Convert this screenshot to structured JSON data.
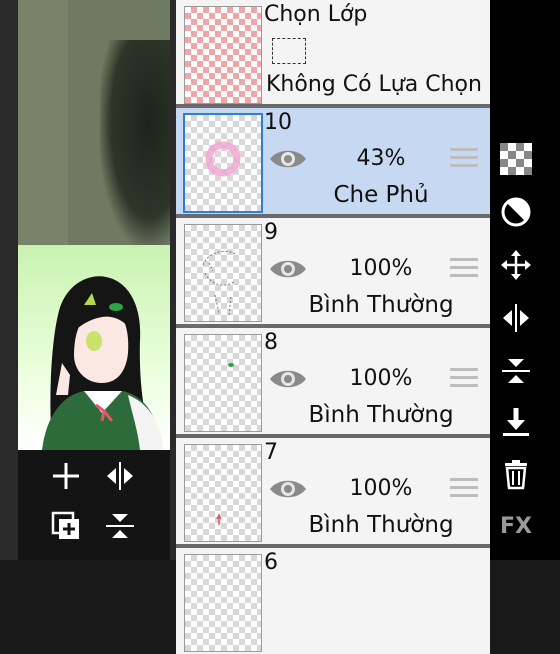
{
  "selection_layer": {
    "title": "Chọn Lớp",
    "status": "Không Có Lựa Chọn"
  },
  "layers": [
    {
      "number": "10",
      "opacity": "43%",
      "blend": "Che Phủ",
      "active": true
    },
    {
      "number": "9",
      "opacity": "100%",
      "blend": "Bình Thường",
      "active": false
    },
    {
      "number": "8",
      "opacity": "100%",
      "blend": "Bình Thường",
      "active": false
    },
    {
      "number": "7",
      "opacity": "100%",
      "blend": "Bình Thường",
      "active": false
    },
    {
      "number": "6",
      "opacity": "",
      "blend": "",
      "active": false
    }
  ],
  "left_tools": [
    "add-layer-icon",
    "flip-horizontal-icon",
    "duplicate-layer-icon",
    "flip-vertical-merge-icon"
  ],
  "right_tools": [
    "transparency-checker-icon",
    "contrast-icon",
    "move-icon",
    "flip-horizontal-icon",
    "flip-vertical-icon",
    "merge-down-icon",
    "trash-icon",
    "fx-icon"
  ],
  "right_labels": {
    "fx": "FX"
  },
  "colors": {
    "active_layer": "#c7d9f2",
    "active_border": "#2f7fd8",
    "background": "#000000"
  }
}
